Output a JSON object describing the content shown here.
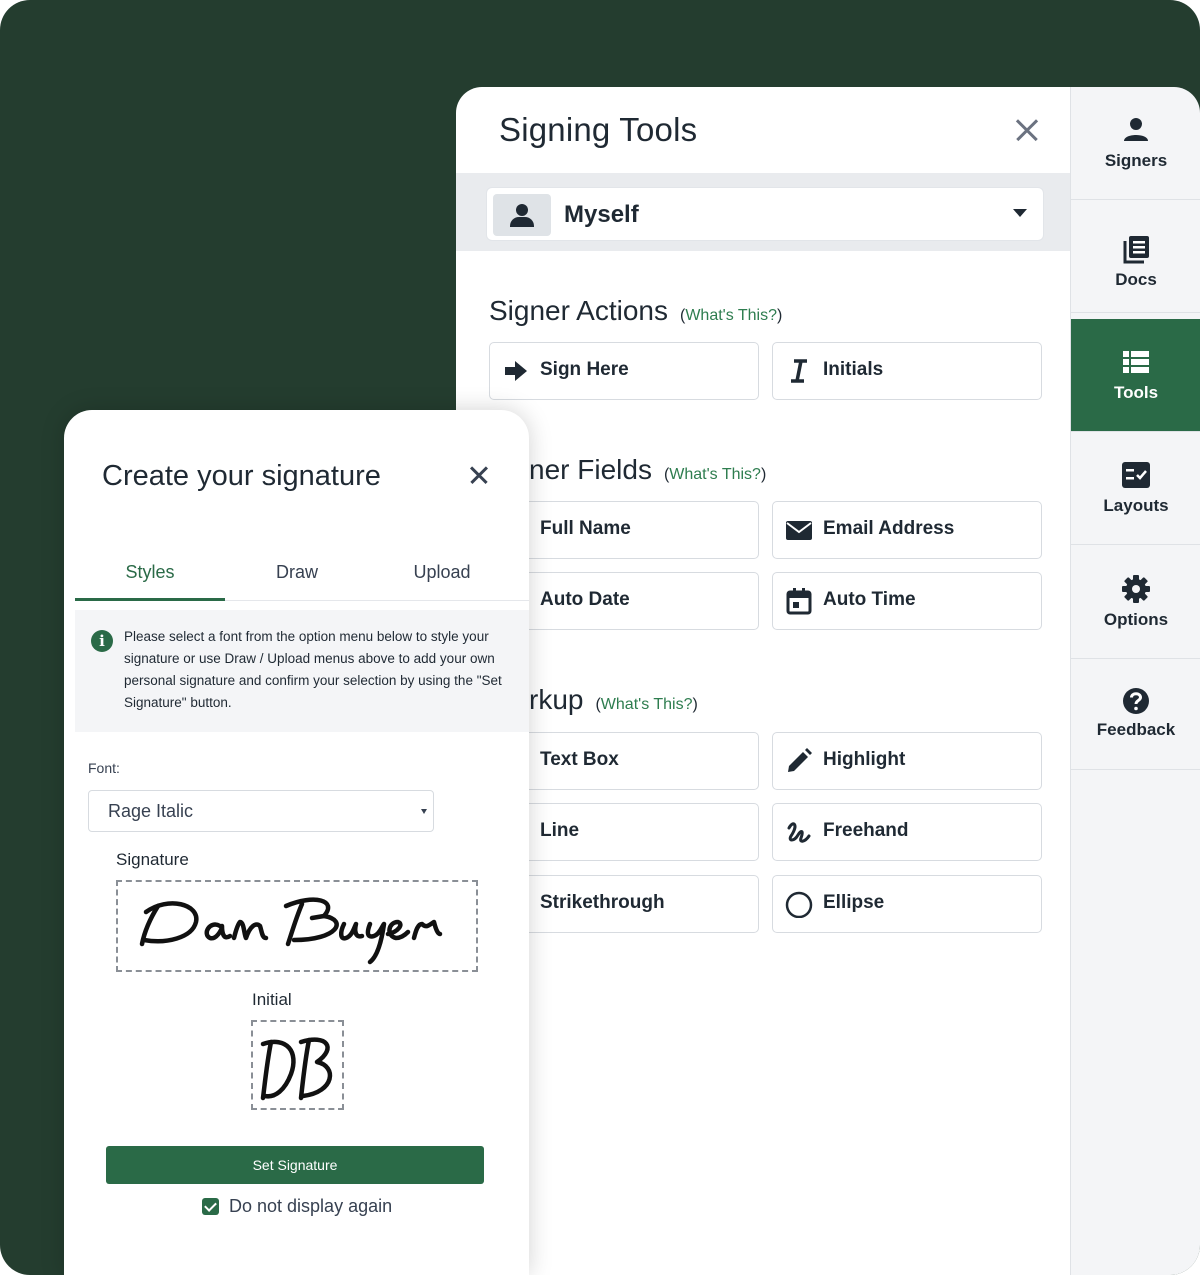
{
  "signing_tools": {
    "title": "Signing Tools",
    "signer_selected": "Myself",
    "signer_actions": {
      "heading": "Signer Actions",
      "whats_this_open": "(",
      "whats_this_link": "What's This?",
      "whats_this_close": ")",
      "buttons": [
        {
          "label": "Sign Here",
          "icon": "arrow-right-icon"
        },
        {
          "label": "Initials",
          "icon": "text-cursor-icon"
        }
      ]
    },
    "signer_fields": {
      "heading": "Signer Fields",
      "heading_visible": "ner Fields",
      "whats_this_open": "(",
      "whats_this_link": "What's This?",
      "whats_this_close": ")",
      "buttons": [
        {
          "label": "Full Name",
          "icon": "user-icon"
        },
        {
          "label": "Email Address",
          "icon": "envelope-icon"
        },
        {
          "label": "Auto Date",
          "icon": "calendar-icon"
        },
        {
          "label": "Auto Time",
          "icon": "calendar-icon"
        }
      ]
    },
    "markup": {
      "heading": "Markup",
      "heading_visible": "rkup",
      "whats_this_open": "(",
      "whats_this_link": "What's This?",
      "whats_this_close": ")",
      "buttons": [
        {
          "label": "Text Box",
          "icon": "text-box-icon"
        },
        {
          "label": "Highlight",
          "icon": "pencil-icon"
        },
        {
          "label": "Line",
          "icon": "line-icon"
        },
        {
          "label": "Freehand",
          "icon": "freehand-icon"
        },
        {
          "label": "Strikethrough",
          "icon": "strikethrough-icon"
        },
        {
          "label": "Ellipse",
          "icon": "circle-icon"
        }
      ]
    }
  },
  "sidebar": {
    "items": [
      {
        "label": "Signers",
        "icon": "person-icon",
        "active": false
      },
      {
        "label": "Docs",
        "icon": "documents-icon",
        "active": false
      },
      {
        "label": "Tools",
        "icon": "list-icon",
        "active": true
      },
      {
        "label": "Layouts",
        "icon": "layout-check-icon",
        "active": false
      },
      {
        "label": "Options",
        "icon": "gear-icon",
        "active": false
      },
      {
        "label": "Feedback",
        "icon": "question-circle-icon",
        "active": false
      }
    ]
  },
  "signature_modal": {
    "title": "Create your signature",
    "tabs": [
      "Styles",
      "Draw",
      "Upload"
    ],
    "active_tab": "Styles",
    "info_text": "Please select a font from the option menu below to style your signature or use Draw / Upload menus above to add your own personal signature and confirm your selection by using the \"Set Signature\" button.",
    "font_label": "Font:",
    "font_value": "Rage Italic",
    "signature_label": "Signature",
    "signature_text": "Dan Buyer",
    "initial_label": "Initial",
    "initial_text": "DB",
    "set_button": "Set Signature",
    "do_not_display_label": "Do not display again",
    "do_not_display_checked": true
  },
  "colors": {
    "backdrop": "#243d2f",
    "accent": "#2a6a47",
    "link": "#2e7d4f",
    "text": "#1f2933"
  }
}
